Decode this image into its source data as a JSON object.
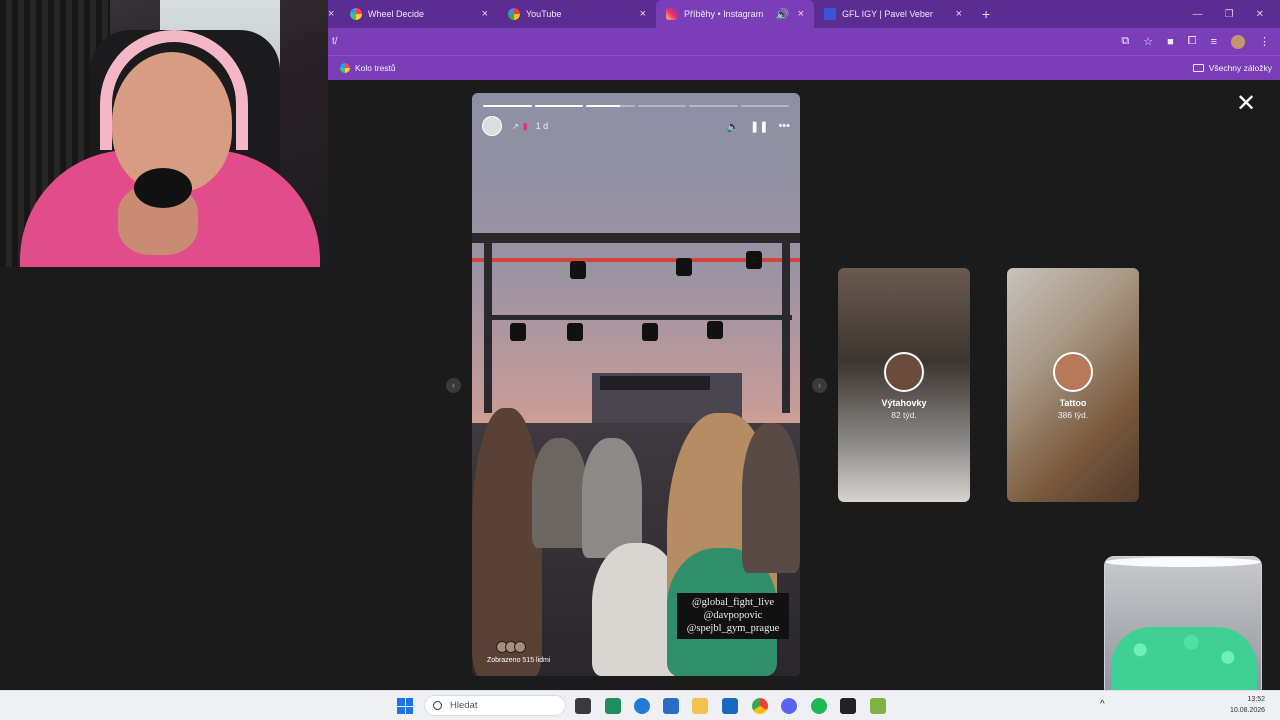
{
  "browser": {
    "tabs": [
      {
        "label": "Wheel Decide",
        "favicon_color": "#e04a3a",
        "active": false
      },
      {
        "label": "YouTube",
        "favicon_color": "#ffffff",
        "active": false
      },
      {
        "label": "Příběhy • Instagram",
        "favicon_color": "#e1306c",
        "active": true
      },
      {
        "label": "GFL IGY | Pavel Veber",
        "favicon_color": "#3a54d6",
        "active": false
      }
    ],
    "address_text": "t/",
    "bookmark_item": "Kolo trestů",
    "bookmarks_folder": "Všechny záložky",
    "accent_color": "#7a3fb8"
  },
  "story": {
    "time_ago": "1 d",
    "tags": [
      "@global_fight_live",
      "@davpopovic",
      "@spejbl_gym_prague"
    ],
    "viewers_text": "Zobrazeno 515 lidmi",
    "progress_segments": [
      1,
      1,
      0.7,
      0,
      0,
      0
    ]
  },
  "highlights": [
    {
      "title": "Výtahovky",
      "subtitle": "82 týd."
    },
    {
      "title": "Tattoo",
      "subtitle": "386 týd."
    }
  ],
  "taskbar": {
    "search_placeholder": "Hledat",
    "time": "13:52",
    "date": "10.08.2026"
  }
}
